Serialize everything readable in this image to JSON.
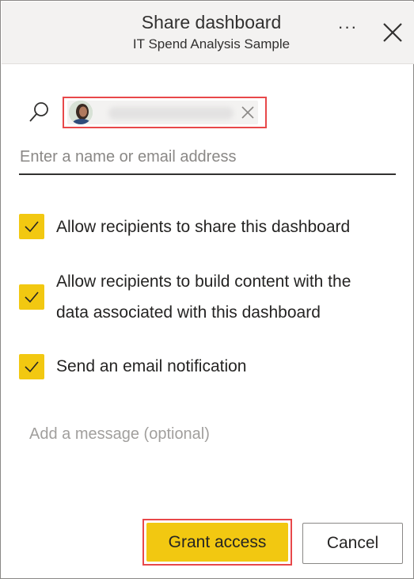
{
  "header": {
    "title": "Share dashboard",
    "subtitle": "IT Spend Analysis Sample",
    "more_label": "···"
  },
  "picker": {
    "placeholder": "Enter a name or email address",
    "chip_icons": [
      "avatar",
      "close-icon"
    ]
  },
  "options": [
    {
      "label_lines": [
        "Allow recipients to share this dashboard"
      ],
      "checked": true
    },
    {
      "label_lines": [
        "Allow recipients to build content with the",
        "data associated with this dashboard"
      ],
      "checked": true
    },
    {
      "label_lines": [
        "Send an email notification"
      ],
      "checked": true
    }
  ],
  "message": {
    "placeholder": "Add a message (optional)"
  },
  "buttons": {
    "grant": "Grant access",
    "cancel": "Cancel"
  },
  "colors": {
    "accent": "#f2c811",
    "highlight": "#e8484a",
    "header_bg": "#f3f2f1"
  }
}
